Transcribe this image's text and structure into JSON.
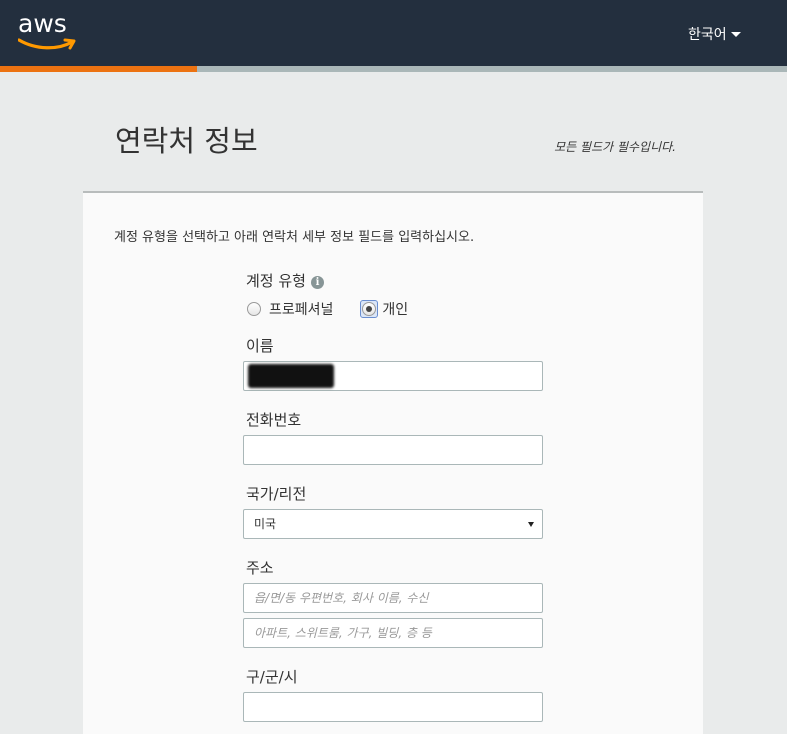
{
  "header": {
    "logo_text": "aws",
    "language": "한국어"
  },
  "progress": {
    "fraction": 0.25
  },
  "page": {
    "title": "연락처 정보",
    "required_note": "모든 필드가 필수입니다.",
    "intro": "계정 유형을 선택하고 아래 연락처 세부 정보 필드를 입력하십시오."
  },
  "form": {
    "account_type_label": "계정 유형",
    "account_type_options": [
      {
        "label": "프로페셔널",
        "checked": false
      },
      {
        "label": "개인",
        "checked": true
      }
    ],
    "name_label": "이름",
    "name_value": "",
    "phone_label": "전화번호",
    "phone_value": "",
    "country_label": "국가/리전",
    "country_value": "미국",
    "address_label": "주소",
    "address1_placeholder": "읍/면/동 우편번호, 회사 이름, 수신",
    "address2_placeholder": "아파트, 스위트룸, 가구, 빌딩, 층 등",
    "city_label": "구/군/시",
    "city_value": ""
  },
  "colors": {
    "header_bg": "#232f3e",
    "progress_fill": "#ec7211",
    "progress_track": "#aab7b8",
    "page_bg": "#e9ebeb"
  },
  "icons": [
    "aws-smile-icon",
    "caret-down-icon",
    "info-icon",
    "select-arrow-icon"
  ]
}
